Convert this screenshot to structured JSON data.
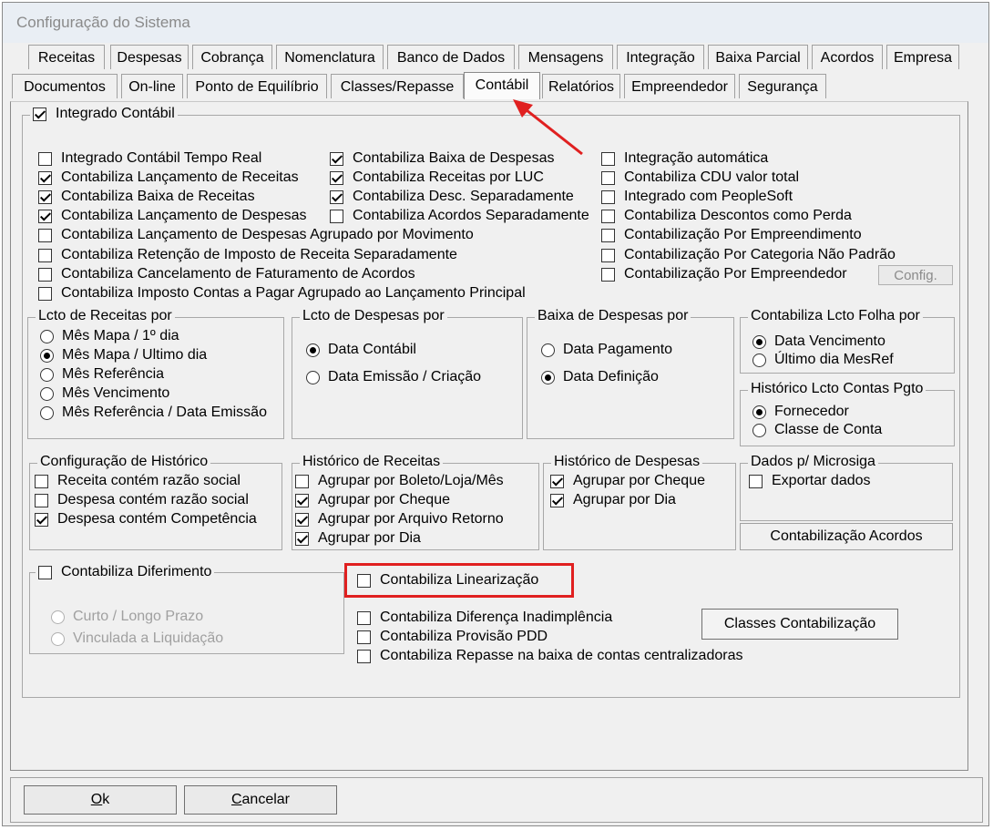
{
  "window": {
    "title": "Configuração do Sistema"
  },
  "tabs_row1": [
    "Receitas",
    "Despesas",
    "Cobrança",
    "Nomenclatura",
    "Banco de Dados",
    "Mensagens",
    "Integração",
    "Baixa Parcial",
    "Acordos",
    "Empresa"
  ],
  "tabs_row2": [
    "Documentos",
    "On-line",
    "Ponto de Equilíbrio",
    "Classes/Repasse",
    "Contábil",
    "Relatórios",
    "Empreendedor",
    "Segurança"
  ],
  "main": {
    "integrado_label": "Integrado Contábil",
    "col1": [
      {
        "label": "Integrado Contábil Tempo Real",
        "checked": false
      },
      {
        "label": "Contabiliza Lançamento de Receitas",
        "checked": true
      },
      {
        "label": "Contabiliza Baixa de Receitas",
        "checked": true
      },
      {
        "label": "Contabiliza Lançamento de Despesas",
        "checked": true
      },
      {
        "label": "Contabiliza Lançamento de Despesas Agrupado por Movimento",
        "checked": false
      },
      {
        "label": "Contabiliza Retenção de Imposto de Receita Separadamente",
        "checked": false
      },
      {
        "label": "Contabiliza Cancelamento de Faturamento de Acordos",
        "checked": false
      },
      {
        "label": "Contabiliza Imposto Contas a Pagar Agrupado ao Lançamento Principal",
        "checked": false
      }
    ],
    "col2": [
      {
        "label": "Contabiliza Baixa de Despesas",
        "checked": true
      },
      {
        "label": "Contabiliza Receitas por LUC",
        "checked": true
      },
      {
        "label": "Contabiliza Desc. Separadamente",
        "checked": true
      },
      {
        "label": "Contabiliza Acordos Separadamente",
        "checked": false
      }
    ],
    "col3": [
      {
        "label": "Integração automática",
        "checked": false
      },
      {
        "label": "Contabiliza CDU valor total",
        "checked": false
      },
      {
        "label": "Integrado com PeopleSoft",
        "checked": false
      },
      {
        "label": "Contabiliza Descontos como Perda",
        "checked": false
      },
      {
        "label": "Contabilização Por Empreendimento",
        "checked": false
      },
      {
        "label": "Contabilização Por Categoria Não Padrão",
        "checked": false
      },
      {
        "label": "Contabilização Por Empreendedor",
        "checked": false
      }
    ],
    "config_button": "Config.",
    "lcto_receitas": {
      "title": "Lcto de Receitas por",
      "options": [
        "Mês Mapa / 1º dia",
        "Mês Mapa / Ultimo dia",
        "Mês Referência",
        "Mês Vencimento",
        "Mês Referência / Data Emissão"
      ],
      "selected": 1
    },
    "lcto_despesas": {
      "title": "Lcto de Despesas por",
      "options": [
        "Data Contábil",
        "Data Emissão / Criação"
      ],
      "selected": 0
    },
    "baixa_despesas": {
      "title": "Baixa de Despesas por",
      "options": [
        "Data Pagamento",
        "Data Definição"
      ],
      "selected": 1
    },
    "folha": {
      "title": "Contabiliza Lcto Folha por",
      "options": [
        "Data Vencimento",
        "Último dia MesRef"
      ],
      "selected": 0
    },
    "hist_contas": {
      "title": "Histórico Lcto Contas Pgto",
      "options": [
        "Fornecedor",
        "Classe de Conta"
      ],
      "selected": 0
    },
    "config_hist": {
      "title": "Configuração de Histórico",
      "items": [
        {
          "label": "Receita contém razão social",
          "checked": false
        },
        {
          "label": "Despesa contém razão social",
          "checked": false
        },
        {
          "label": "Despesa contém Competência",
          "checked": true
        }
      ]
    },
    "hist_receitas": {
      "title": "Histórico de Receitas",
      "items": [
        {
          "label": "Agrupar por Boleto/Loja/Mês",
          "checked": false
        },
        {
          "label": "Agrupar por Cheque",
          "checked": true
        },
        {
          "label": "Agrupar por Arquivo Retorno",
          "checked": true
        },
        {
          "label": "Agrupar por Dia",
          "checked": true
        }
      ]
    },
    "hist_despesas": {
      "title": "Histórico de Despesas",
      "items": [
        {
          "label": "Agrupar por Cheque",
          "checked": true
        },
        {
          "label": "Agrupar por Dia",
          "checked": true
        }
      ]
    },
    "microsiga": {
      "title": "Dados p/ Microsiga",
      "items": [
        {
          "label": "Exportar dados",
          "checked": false
        }
      ]
    },
    "acordos_button": "Contabilização Acordos",
    "diferimento": {
      "title": "Contabiliza Diferimento",
      "checked": false,
      "options": [
        "Curto / Longo Prazo",
        "Vinculada a Liquidação"
      ]
    },
    "lower": [
      {
        "label": "Contabiliza Linearização",
        "checked": false
      },
      {
        "label": "Contabiliza Diferença Inadimplência",
        "checked": false
      },
      {
        "label": "Contabiliza Provisão PDD",
        "checked": false
      },
      {
        "label": "Contabiliza Repasse na baixa de contas centralizadoras",
        "checked": false
      }
    ],
    "classes_button": "Classes Contabilização"
  },
  "footer": {
    "ok_rest": "k",
    "ok_key": "O",
    "cancel_key": "C",
    "cancel_rest": "ancelar"
  },
  "colors": {
    "highlight": "#e02020",
    "arrow": "#e02020"
  }
}
